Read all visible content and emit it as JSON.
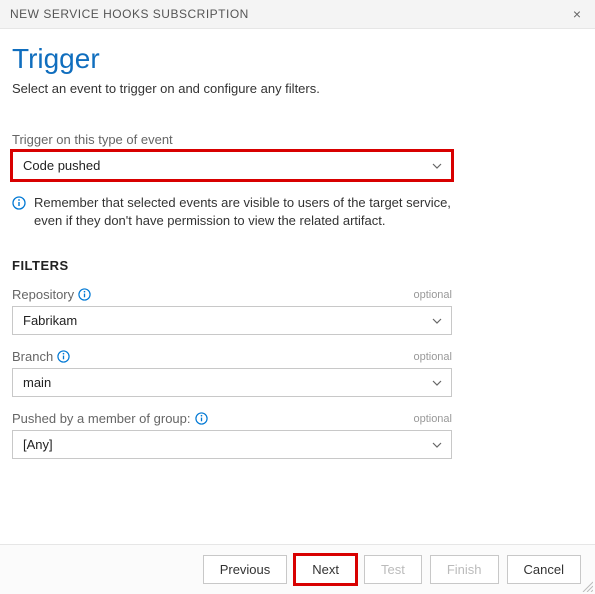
{
  "titlebar": {
    "title": "NEW SERVICE HOOKS SUBSCRIPTION",
    "close": "×"
  },
  "heading": "Trigger",
  "subtitle": "Select an event to trigger on and configure any filters.",
  "event": {
    "label": "Trigger on this type of event",
    "value": "Code pushed"
  },
  "info_text": "Remember that selected events are visible to users of the target service, even if they don't have permission to view the related artifact.",
  "filters_heading": "FILTERS",
  "filters": {
    "repository": {
      "label": "Repository",
      "optional": "optional",
      "value": "Fabrikam"
    },
    "branch": {
      "label": "Branch",
      "optional": "optional",
      "value": "main"
    },
    "group": {
      "label": "Pushed by a member of group:",
      "optional": "optional",
      "value": "[Any]"
    }
  },
  "buttons": {
    "previous": "Previous",
    "next": "Next",
    "test": "Test",
    "finish": "Finish",
    "cancel": "Cancel"
  }
}
